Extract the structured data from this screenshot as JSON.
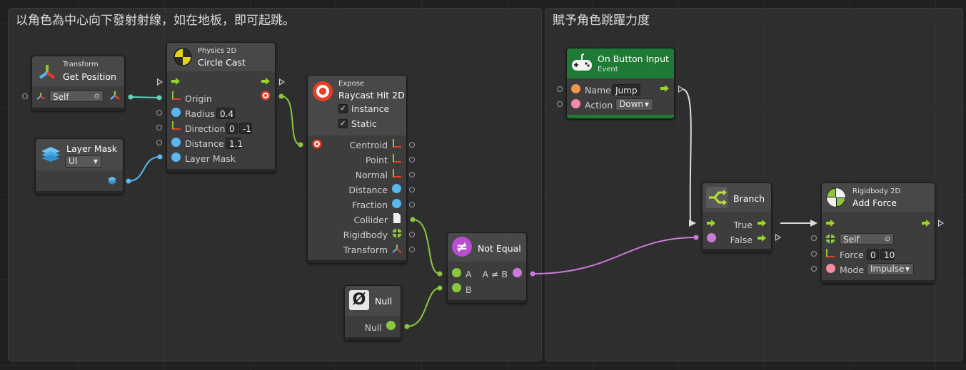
{
  "groups": {
    "left_title": "以角色為中心向下發射射線，如在地板，即可起跳。",
    "right_title": "賦予角色跳躍力度"
  },
  "nodes": {
    "transform": {
      "category": "Transform",
      "title": "Get Position",
      "self_value": "Self"
    },
    "layermask": {
      "title": "Layer Mask",
      "value": "UI"
    },
    "circlecast": {
      "category": "Physics 2D",
      "title": "Circle Cast",
      "origin": "Origin",
      "radius": "Radius",
      "radius_value": "0.4",
      "direction": "Direction",
      "dir_x": "0",
      "dir_y": "-1",
      "distance": "Distance",
      "distance_value": "1.1",
      "layer_mask": "Layer Mask"
    },
    "expose": {
      "category": "Expose",
      "title": "Raycast Hit 2D",
      "instance": "Instance",
      "static": "Static",
      "outputs": [
        "Centroid",
        "Point",
        "Normal",
        "Distance",
        "Fraction",
        "Collider",
        "Rigidbody",
        "Transform"
      ]
    },
    "null": {
      "title": "Null",
      "output": "Null"
    },
    "notequal": {
      "title": "Not Equal",
      "a": "A",
      "b": "B",
      "out": "A ≠ B"
    },
    "button": {
      "title": "On Button Input",
      "subtitle": "Event",
      "name": "Name",
      "name_value": "Jump",
      "action": "Action",
      "action_value": "Down"
    },
    "branch": {
      "title": "Branch",
      "true": "True",
      "false": "False"
    },
    "addforce": {
      "category": "Rigidbody 2D",
      "title": "Add Force",
      "self_value": "Self",
      "force": "Force",
      "force_x": "0",
      "force_y": "10",
      "mode": "Mode",
      "mode_value": "Impulse"
    }
  },
  "colors": {
    "flow": "#9bd62a",
    "float": "#5ab8f0",
    "bool": "#cc7ad9",
    "object": "#8cc63f",
    "vector_x": "#ea3d23",
    "vector_y": "#8cc63f",
    "event_header": "#1e7a35"
  },
  "icons": [
    "move-gizmo-icon",
    "layers-icon",
    "circle-cast-icon",
    "target-icon",
    "null-icon",
    "not-equal-icon",
    "gamepad-icon",
    "branch-icon",
    "rigidbody-icon"
  ]
}
